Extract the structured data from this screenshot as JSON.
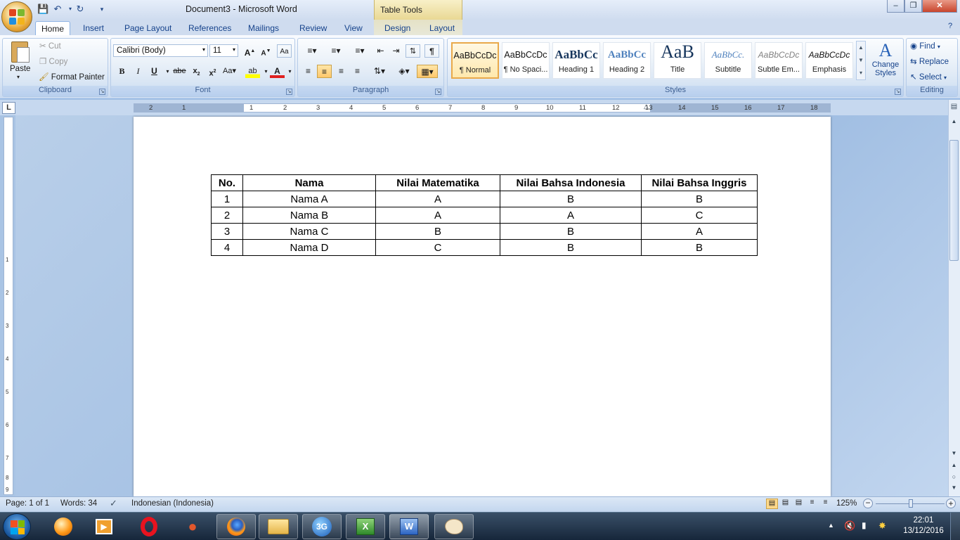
{
  "window": {
    "title": "Document3 - Microsoft Word",
    "contextual_tab_group": "Table Tools"
  },
  "tabs": [
    "Home",
    "Insert",
    "Page Layout",
    "References",
    "Mailings",
    "Review",
    "View",
    "Design",
    "Layout"
  ],
  "clipboard": {
    "paste": "Paste",
    "cut": "Cut",
    "copy": "Copy",
    "format_painter": "Format Painter",
    "label": "Clipboard"
  },
  "font": {
    "name": "Calibri (Body)",
    "size": "11",
    "label": "Font"
  },
  "paragraph": {
    "label": "Paragraph"
  },
  "styles": {
    "label": "Styles",
    "items": [
      {
        "preview": "AaBbCcDc",
        "name": "¶ Normal"
      },
      {
        "preview": "AaBbCcDc",
        "name": "¶ No Spaci..."
      },
      {
        "preview": "AaBbCc",
        "name": "Heading 1"
      },
      {
        "preview": "AaBbCc",
        "name": "Heading 2"
      },
      {
        "preview": "AaB",
        "name": "Title"
      },
      {
        "preview": "AaBbCc.",
        "name": "Subtitle"
      },
      {
        "preview": "AaBbCcDc",
        "name": "Subtle Em..."
      },
      {
        "preview": "AaBbCcDc",
        "name": "Emphasis"
      }
    ],
    "change_styles": "Change Styles"
  },
  "editing": {
    "find": "Find",
    "replace": "Replace",
    "select": "Select",
    "label": "Editing"
  },
  "ruler": {
    "numbers": [
      "2",
      "1",
      "1",
      "2",
      "3",
      "4",
      "5",
      "6",
      "7",
      "8",
      "9",
      "10",
      "11",
      "12",
      "13",
      "14",
      "15",
      "16",
      "17",
      "18"
    ]
  },
  "vruler": {
    "numbers": [
      "1",
      "2",
      "3",
      "4",
      "5",
      "6",
      "7",
      "8",
      "9"
    ]
  },
  "table": {
    "headers": [
      "No.",
      "Nama",
      "Nilai Matematika",
      "Nilai Bahsa Indonesia",
      "Nilai Bahsa Inggris"
    ],
    "rows": [
      [
        "1",
        "Nama A",
        "A",
        "B",
        "B"
      ],
      [
        "2",
        "Nama B",
        "A",
        "A",
        "C"
      ],
      [
        "3",
        "Nama C",
        "B",
        "B",
        "A"
      ],
      [
        "4",
        "Nama D",
        "C",
        "B",
        "B"
      ]
    ]
  },
  "status": {
    "page": "Page: 1 of 1",
    "words": "Words: 34",
    "language": "Indonesian (Indonesia)",
    "zoom": "125%"
  },
  "taskbar": {
    "time": "22:01",
    "date": "13/12/2016",
    "apps": [
      "orange-ball-icon",
      "media-player-icon",
      "opera-icon",
      "fish-icon",
      "firefox-icon",
      "folder-icon",
      "3g-icon",
      "excel-icon",
      "word-icon",
      "paint-icon"
    ]
  }
}
